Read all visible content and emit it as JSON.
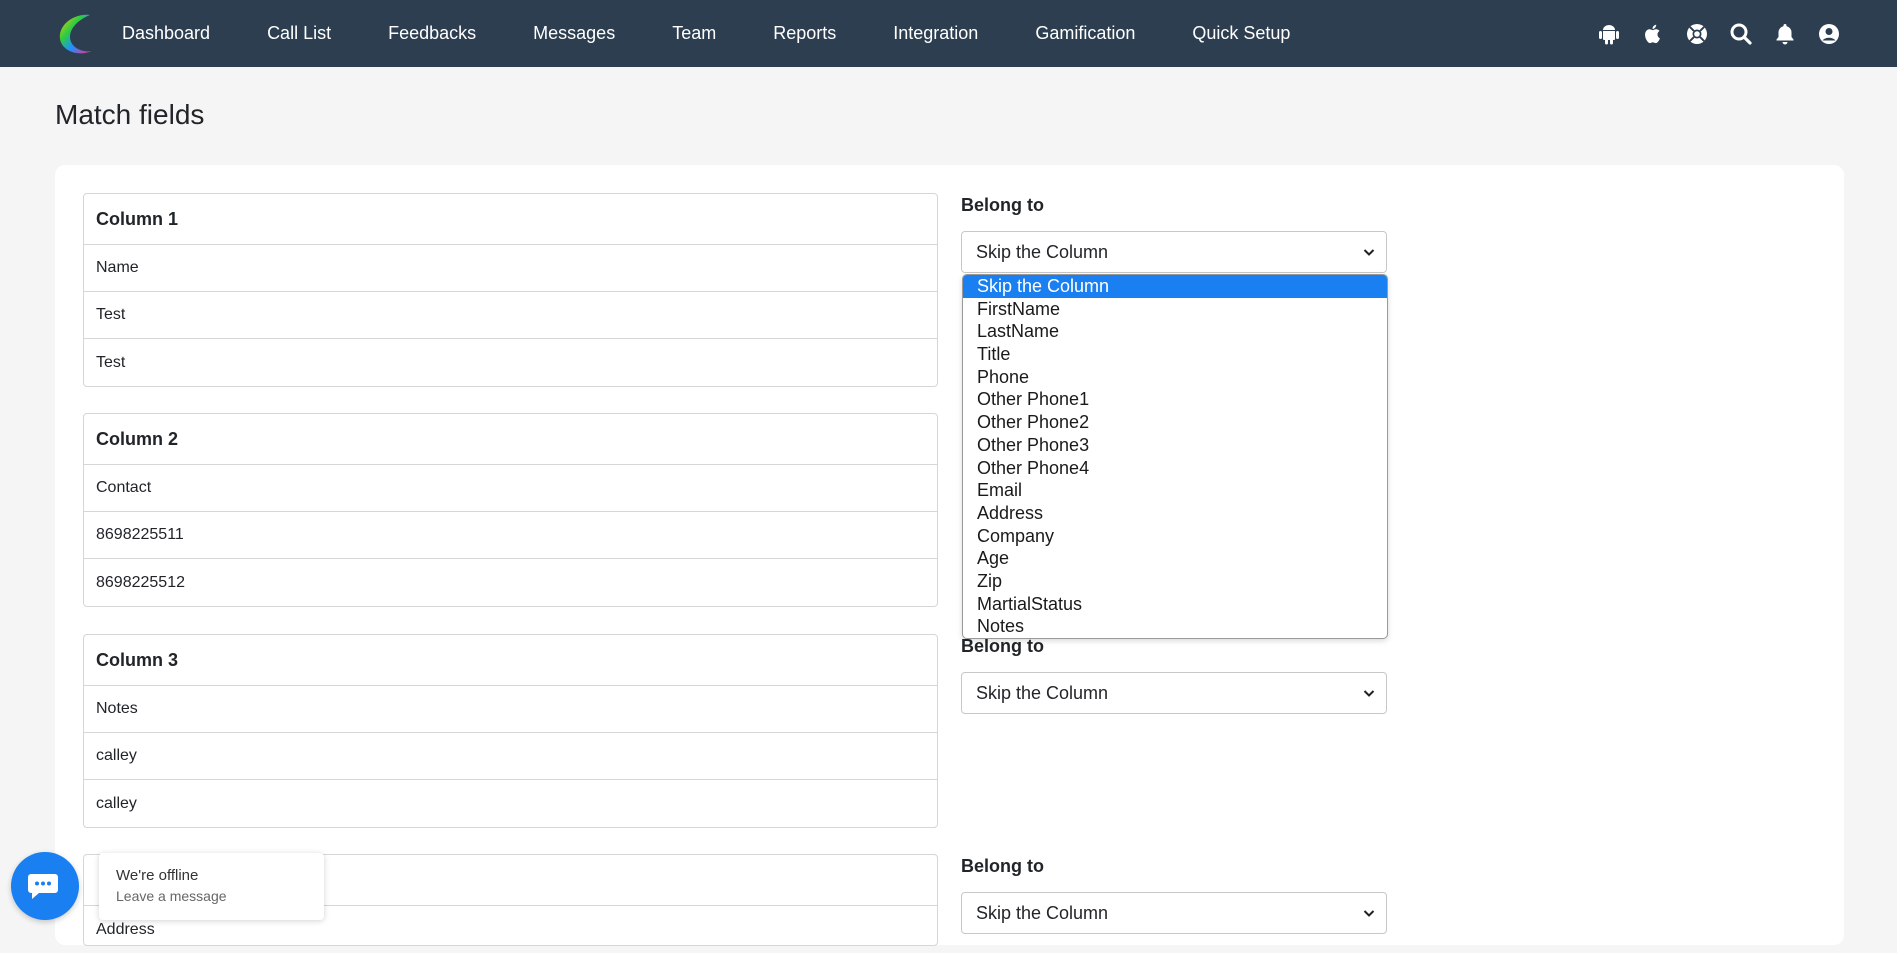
{
  "nav": {
    "items": [
      "Dashboard",
      "Call List",
      "Feedbacks",
      "Messages",
      "Team",
      "Reports",
      "Integration",
      "Gamification",
      "Quick Setup"
    ],
    "icons": [
      "android-icon",
      "apple-icon",
      "support-icon",
      "search-icon",
      "bell-icon",
      "user-icon"
    ]
  },
  "page": {
    "title": "Match fields"
  },
  "columns": [
    {
      "header": "Column 1",
      "rows": [
        "Name",
        "Test",
        "Test"
      ]
    },
    {
      "header": "Column 2",
      "rows": [
        "Contact",
        "8698225511",
        "8698225512"
      ]
    },
    {
      "header": "Column 3",
      "rows": [
        "Notes",
        "calley",
        "calley"
      ]
    },
    {
      "header": "",
      "rows": [
        "Address"
      ]
    }
  ],
  "belong": {
    "label": "Belong to",
    "selected": "Skip the Column"
  },
  "dropdown": {
    "options": [
      "Skip the Column",
      "FirstName",
      "LastName",
      "Title",
      "Phone",
      "Other Phone1",
      "Other Phone2",
      "Other Phone3",
      "Other Phone4",
      "Email",
      "Address",
      "Company",
      "Age",
      "Zip",
      "MartialStatus",
      "Notes"
    ],
    "highlighted": "Skip the Column"
  },
  "chat": {
    "status": "We're offline",
    "action": "Leave a message"
  },
  "colors": {
    "nav_bg": "#2c3e50",
    "accent": "#1a7ff0",
    "page_bg": "#f5f5f5"
  }
}
